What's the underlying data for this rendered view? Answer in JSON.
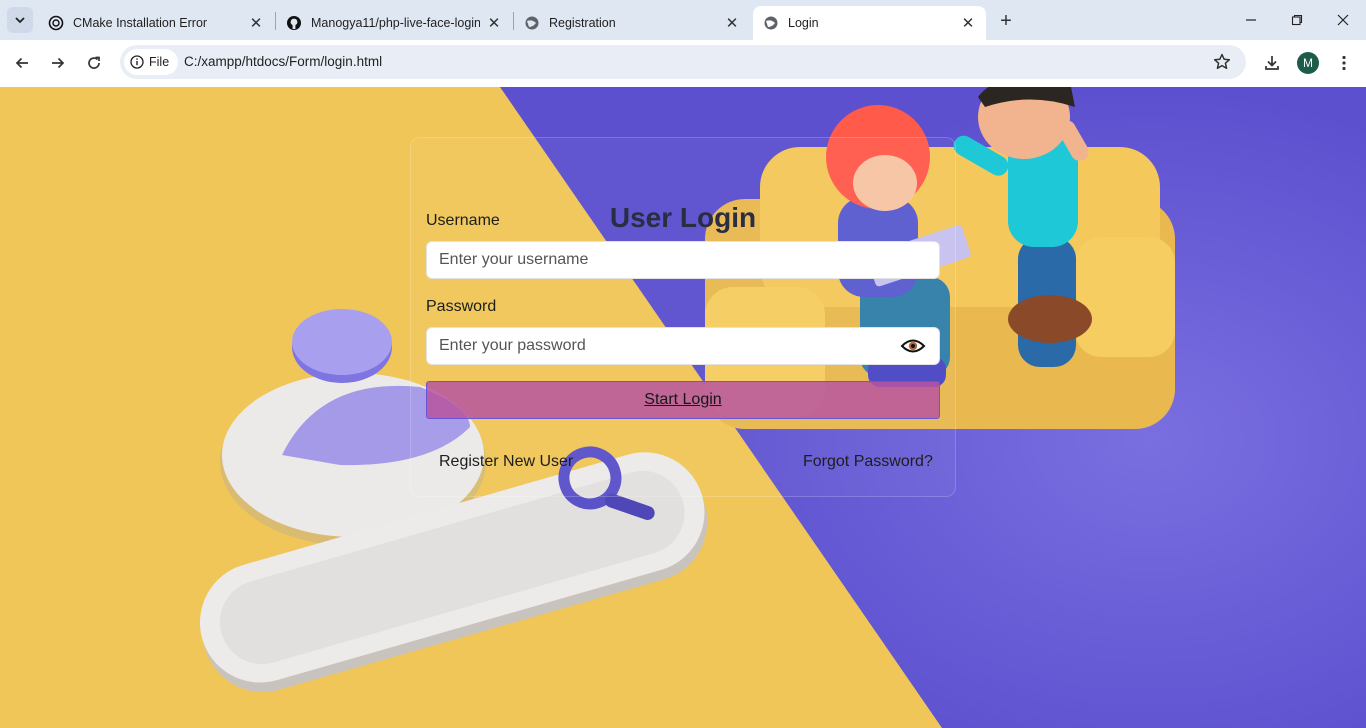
{
  "browser": {
    "tabs": [
      {
        "title": "CMake Installation Error",
        "active": false
      },
      {
        "title": "Manogya11/php-live-face-login",
        "active": false
      },
      {
        "title": "Registration",
        "active": false
      },
      {
        "title": "Login",
        "active": true
      }
    ],
    "url_scheme_chip": "File",
    "url": "C:/xampp/htdocs/Form/login.html",
    "profile_initial": "M"
  },
  "login": {
    "title": "User Login",
    "username_label": "Username",
    "username_placeholder": "Enter your username",
    "username_value": "",
    "password_label": "Password",
    "password_placeholder": "Enter your password",
    "password_value": "",
    "submit_label": "Start Login",
    "register_link": "Register New User",
    "forgot_link": "Forgot Password?"
  },
  "colors": {
    "background_yellow": "#f0c658",
    "background_purple": "#6a5fd6",
    "submit_button": "#b755a0",
    "title_text": "#2b2d42"
  }
}
